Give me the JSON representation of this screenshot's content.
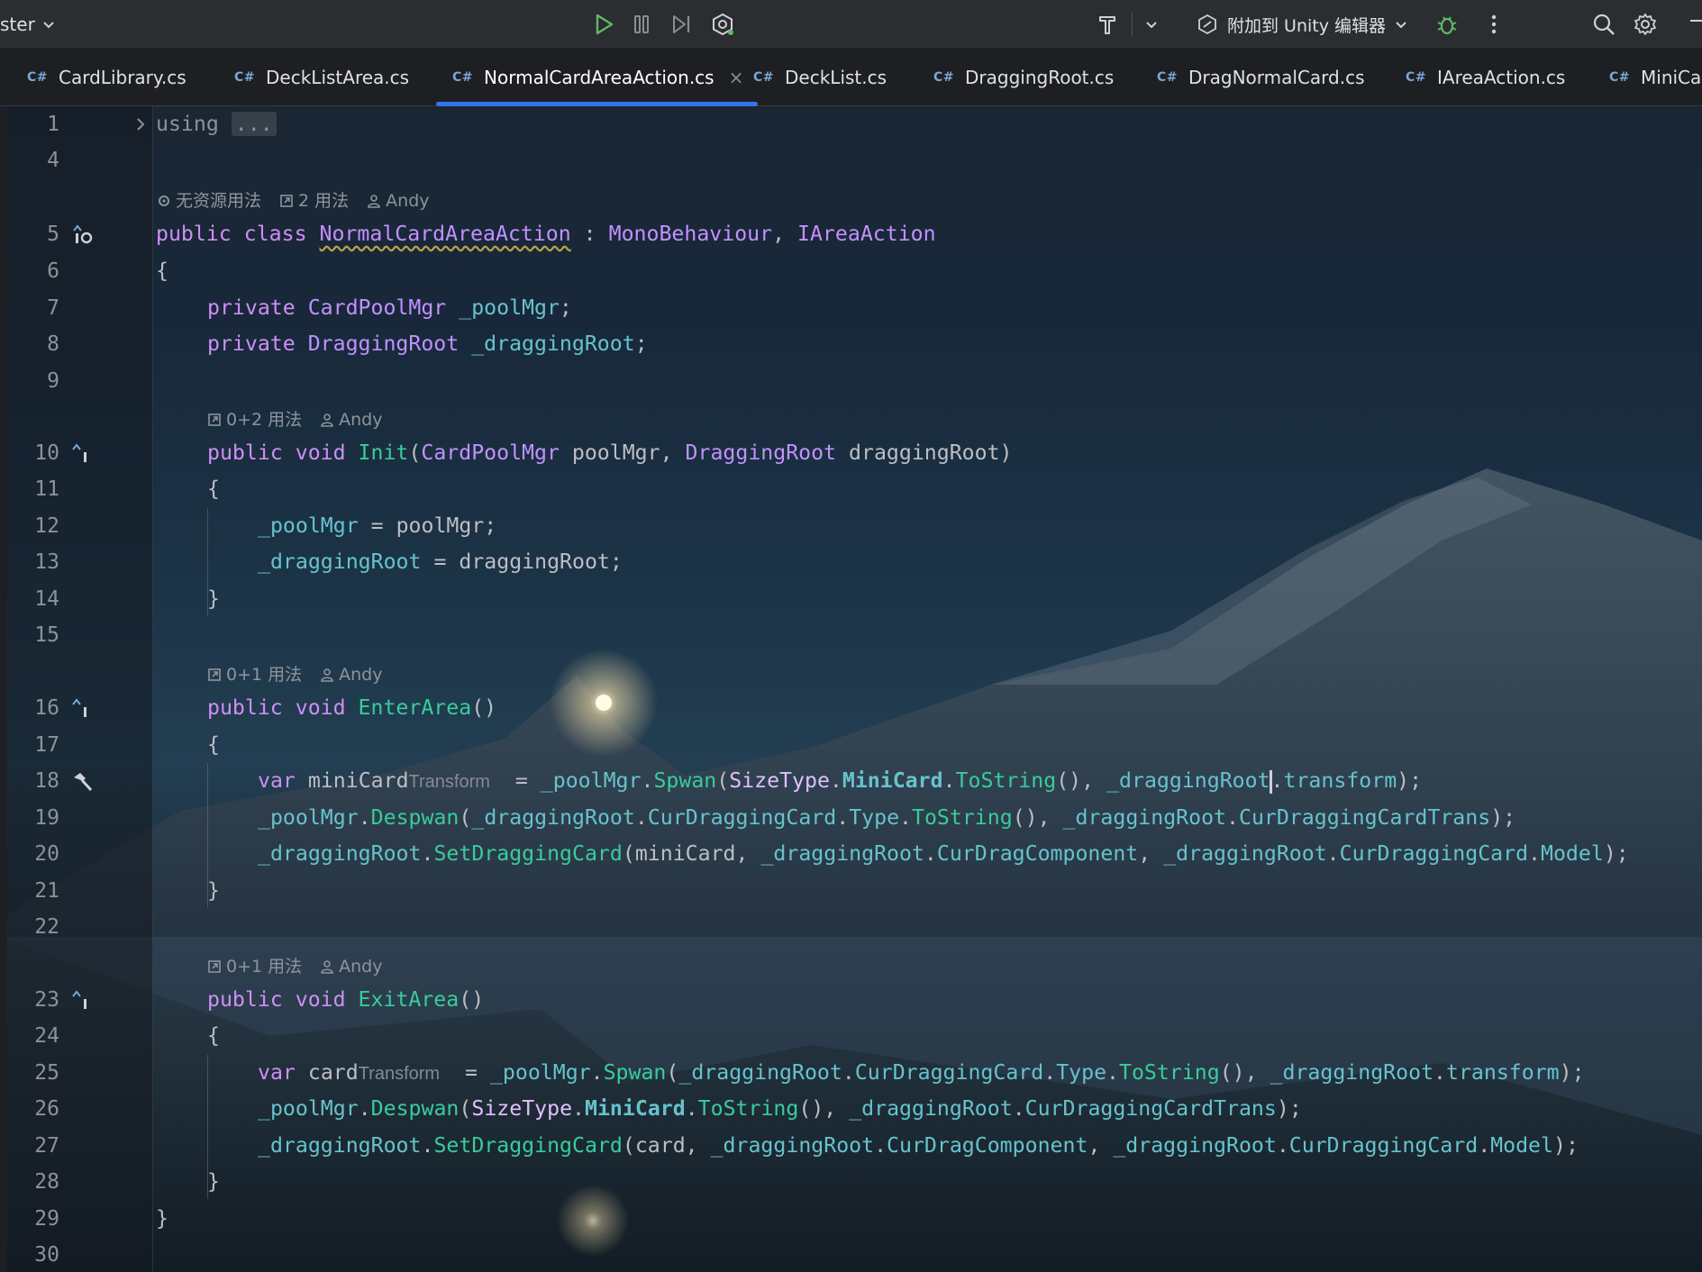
{
  "toolbar": {
    "branch_label": "ster",
    "attach_label": "附加到 Unity 编辑器"
  },
  "tabs": [
    {
      "prefix": "C#",
      "label": "CardLibrary.cs",
      "active": false
    },
    {
      "prefix": "C#",
      "label": "DeckListArea.cs",
      "active": false
    },
    {
      "prefix": "C#",
      "label": "NormalCardAreaAction.cs",
      "active": true,
      "close": "×"
    },
    {
      "prefix": "C#",
      "label": "DeckList.cs",
      "active": false
    },
    {
      "prefix": "C#",
      "label": "DraggingRoot.cs",
      "active": false
    },
    {
      "prefix": "C#",
      "label": "DragNormalCard.cs",
      "active": false
    },
    {
      "prefix": "C#",
      "label": "IAreaAction.cs",
      "active": false
    },
    {
      "prefix": "C#",
      "label": "MiniCar",
      "active": false
    }
  ],
  "lenses": {
    "class": {
      "no_asset": "无资源用法",
      "usages": "2 用法",
      "author": "Andy"
    },
    "init": {
      "usages": "0+2 用法",
      "author": "Andy"
    },
    "enter": {
      "usages": "0+1 用法",
      "author": "Andy"
    },
    "exit": {
      "usages": "0+1 用法",
      "author": "Andy"
    }
  },
  "line_numbers": [
    "1",
    "4",
    "5",
    "6",
    "7",
    "8",
    "9",
    "10",
    "11",
    "12",
    "13",
    "14",
    "15",
    "16",
    "17",
    "18",
    "19",
    "20",
    "21",
    "22",
    "23",
    "24",
    "25",
    "26",
    "27",
    "28",
    "29",
    "30"
  ],
  "code": {
    "l1_using": "using",
    "l1_fold": "...",
    "l5_public": "public",
    "l5_class": "class",
    "l5_name": "NormalCardAreaAction",
    "l5_colon": " : ",
    "l5_base": "MonoBehaviour",
    "l5_comma": ", ",
    "l5_iface": "IAreaAction",
    "brace_open": "{",
    "brace_close": "}",
    "private": "private",
    "l7_type": "CardPoolMgr",
    "l7_field": "_poolMgr",
    "l8_type": "DraggingRoot",
    "l8_field": "_draggingRoot",
    "semi": ";",
    "void": "void",
    "l10_name": "Init",
    "l10_p1type": "CardPoolMgr",
    "l10_p1": " poolMgr, ",
    "l10_p2type": "DraggingRoot",
    "l10_p2": " draggingRoot)",
    "l12_field": "_poolMgr",
    "l12_rest": " = poolMgr;",
    "l13_field": "_draggingRoot",
    "l13_rest": " = draggingRoot;",
    "l16_name": "EnterArea",
    "parens": "()",
    "var": "var",
    "l18_local": "miniCard",
    "hint_transform": "Transform",
    "l25_local": "card",
    "poolMgr": "_poolMgr",
    "draggingRoot": "_draggingRoot",
    "spwan": "Spwan",
    "despwan": "Despwan",
    "setDraggingCard": "SetDraggingCard",
    "sizeType": "SizeType",
    "miniCardEnum": "MiniCard",
    "toString": "ToString",
    "transform": "transform",
    "curDraggingCard": "CurDraggingCard",
    "type": "Type",
    "curDraggingCardTrans": "CurDraggingCardTrans",
    "curDragComponent": "CurDragComponent",
    "model": "Model",
    "miniCardArg": "miniCard",
    "cardArg": "card",
    "l23_name": "ExitArea"
  }
}
